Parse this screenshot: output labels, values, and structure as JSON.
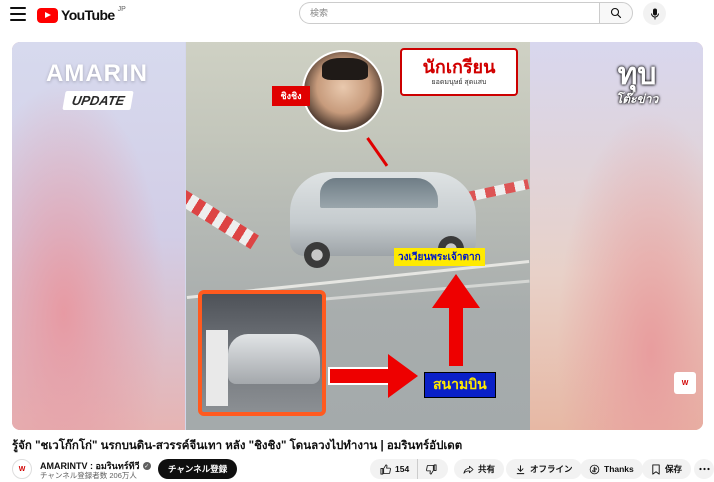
{
  "header": {
    "logo_text": "YouTube",
    "logo_region": "JP",
    "search_placeholder": "検索"
  },
  "player": {
    "brand_left": "AMARIN",
    "brand_update": "UPDATE",
    "brand_right_big": "ทุบ",
    "brand_right_small": "โต๊ะข่าว",
    "sign_title": "นักเกรียน",
    "sign_sub": "ยอดมนุษย์ สุดแสบ",
    "label_red": "ชิงชิง",
    "label_yellow": "วงเวียนพระเจ้าตาก",
    "label_blue": "สนามบิน",
    "watermark": "W"
  },
  "video": {
    "title": "รู้จัก \"ชเวโก๊กโก่\" นรกบนดิน-สวรรค์จีนเทา หลัง \"ชิงชิง\" โดนลวงไปทำงาน | อมรินทร์อัปเดต"
  },
  "channel": {
    "avatar_text": "W",
    "name": "AMARINTV : อมรินทร์ทีวี",
    "subscribers": "チャンネル登録者数 206万人",
    "subscribe_label": "チャンネル登録"
  },
  "actions": {
    "like_count": "154",
    "share_label": "共有",
    "offline_label": "オフライン",
    "thanks_label": "Thanks",
    "save_label": "保存"
  },
  "colors": {
    "brand_red": "#ff0000",
    "subscribe_bg": "#0f0f0f",
    "pill_bg": "#f2f2f2"
  },
  "icons": [
    "menu-icon",
    "youtube-logo-icon",
    "search-icon",
    "mic-icon",
    "verified-icon",
    "like-icon",
    "dislike-icon",
    "share-icon",
    "download-icon",
    "thanks-icon",
    "save-icon",
    "more-icon"
  ]
}
